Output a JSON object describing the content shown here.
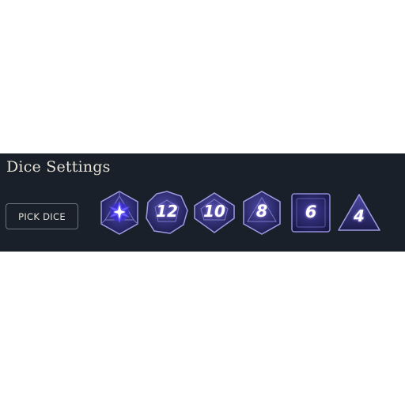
{
  "panel": {
    "title": "Dice Settings",
    "pick_button_label": "PICK DICE"
  },
  "colors": {
    "panel_background": "#19202a",
    "die_fill": "#2b2a6e",
    "die_edge": "#8e8cd6",
    "die_highlight": "#c9c4ff"
  },
  "dice": [
    {
      "name": "d20",
      "icon": "starburst",
      "label": ""
    },
    {
      "name": "d12",
      "label": "12"
    },
    {
      "name": "d10",
      "label": "10"
    },
    {
      "name": "d8",
      "label": "8"
    },
    {
      "name": "d6",
      "label": "6"
    },
    {
      "name": "d4",
      "label": "4"
    }
  ]
}
